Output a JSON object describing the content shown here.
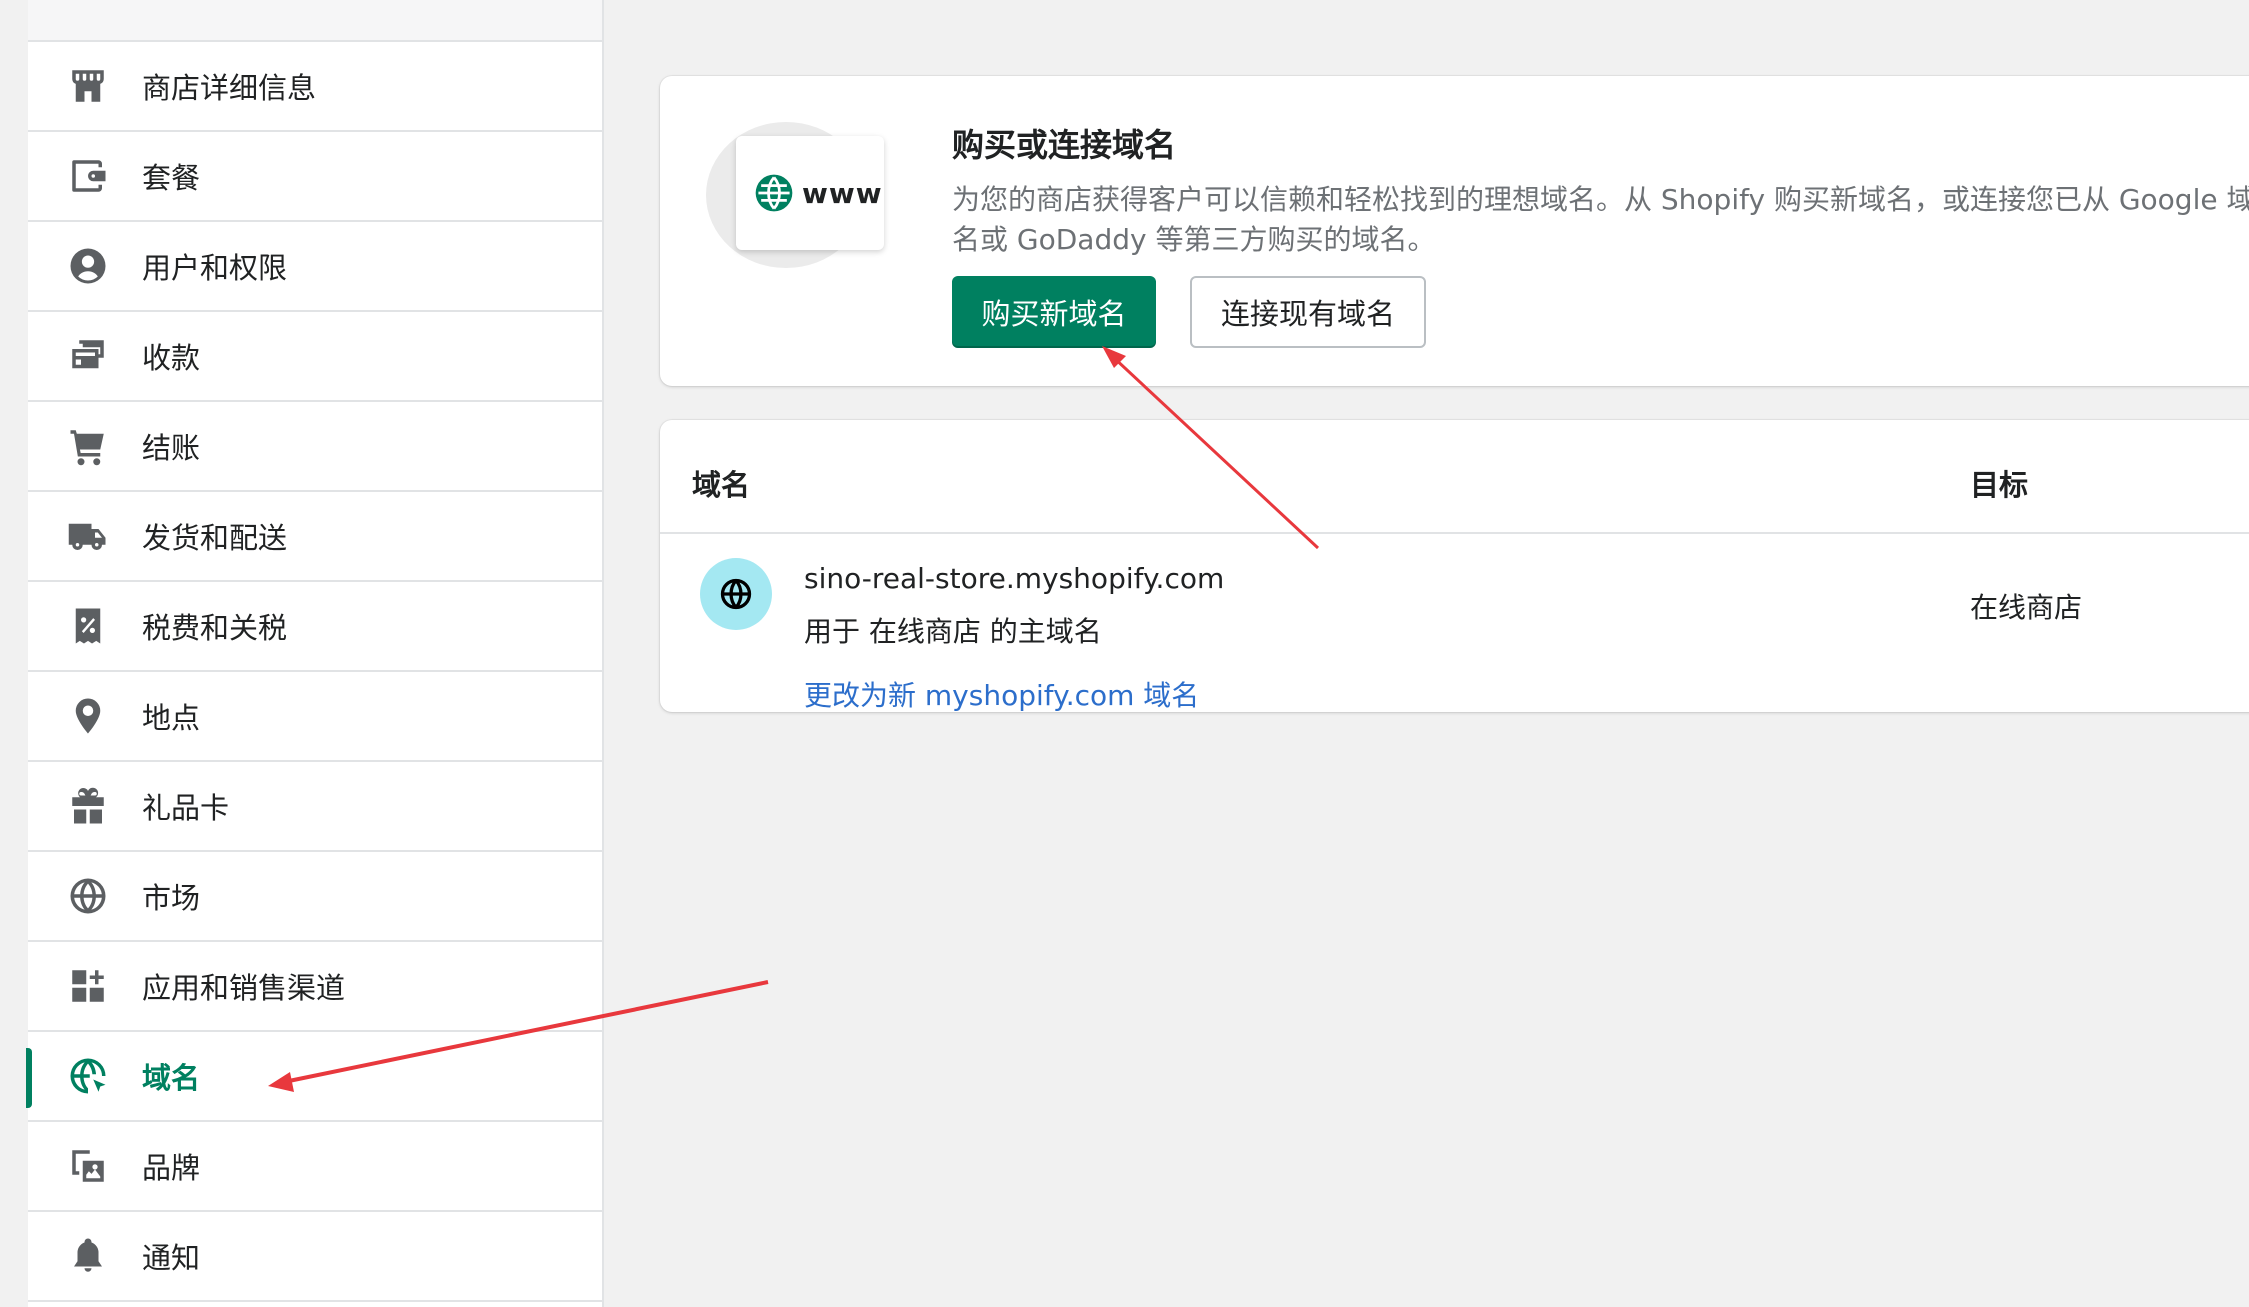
{
  "sidebar": {
    "items": [
      {
        "label": "商店详细信息",
        "icon": "store-icon"
      },
      {
        "label": "套餐",
        "icon": "wallet-icon"
      },
      {
        "label": "用户和权限",
        "icon": "user-icon"
      },
      {
        "label": "收款",
        "icon": "payments-icon"
      },
      {
        "label": "结账",
        "icon": "cart-icon"
      },
      {
        "label": "发货和配送",
        "icon": "truck-icon"
      },
      {
        "label": "税费和关税",
        "icon": "tax-icon"
      },
      {
        "label": "地点",
        "icon": "location-icon"
      },
      {
        "label": "礼品卡",
        "icon": "gift-icon"
      },
      {
        "label": "市场",
        "icon": "globe-icon"
      },
      {
        "label": "应用和销售渠道",
        "icon": "apps-icon"
      },
      {
        "label": "域名",
        "icon": "domain-globe-icon",
        "active": true
      },
      {
        "label": "品牌",
        "icon": "brand-icon"
      },
      {
        "label": "通知",
        "icon": "bell-icon"
      }
    ]
  },
  "buy_card": {
    "illustration_text": "www",
    "title": "购买或连接域名",
    "description": "为您的商店获得客户可以信赖和轻松找到的理想域名。从 Shopify 购买新域名，或连接您已从 Google 域名或 GoDaddy 等第三方购买的域名。",
    "primary_button": "购买新域名",
    "secondary_button": "连接现有域名"
  },
  "domains_table": {
    "headers": {
      "domain": "域名",
      "target": "目标"
    },
    "rows": [
      {
        "domain": "sino-real-store.myshopify.com",
        "subtitle": "用于 在线商店 的主域名",
        "link": "更改为新 myshopify.com 域名",
        "target": "在线商店"
      }
    ]
  },
  "colors": {
    "accent": "#008060",
    "link": "#2c6ecb",
    "annotation_arrow": "#e8383d",
    "avatar_bg": "#a4e8f2"
  }
}
